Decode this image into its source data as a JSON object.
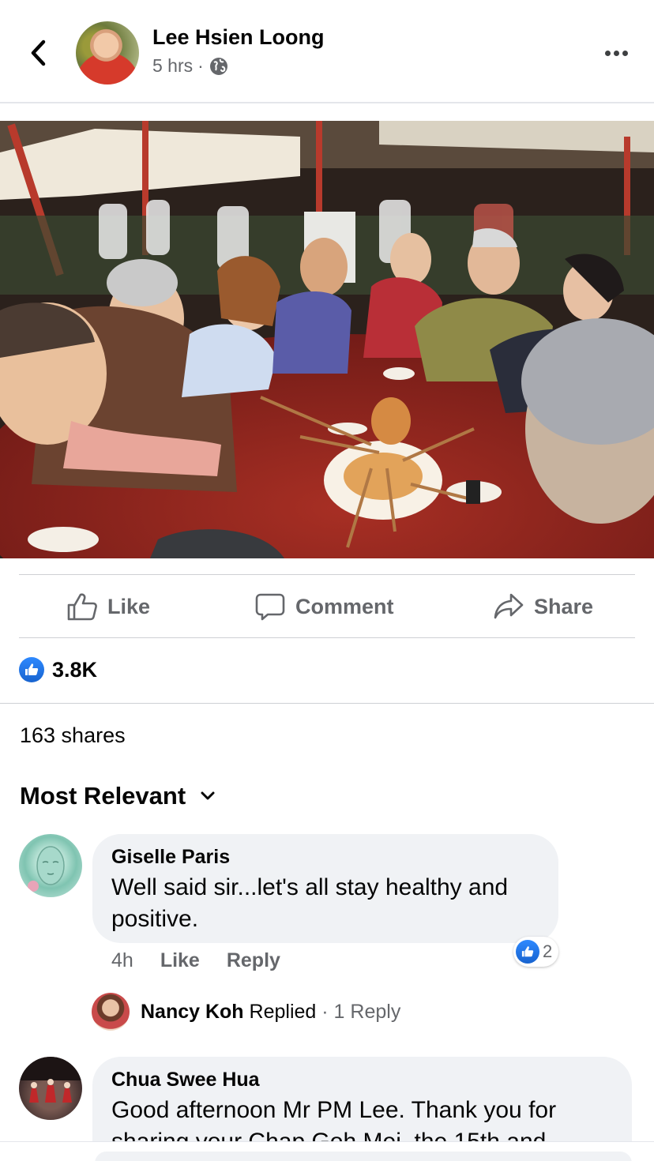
{
  "header": {
    "poster_name": "Lee Hsien Loong",
    "time": "5 hrs",
    "separator": "·",
    "privacy_icon": "globe-icon",
    "back_icon": "chevron-left-icon",
    "more_icon": "more-horizontal-icon"
  },
  "post": {
    "photo_icon": "post-photo"
  },
  "actions": {
    "like": "Like",
    "comment": "Comment",
    "share": "Share"
  },
  "reactions": {
    "type": "like",
    "count": "3.8K"
  },
  "shares": "163 shares",
  "sort": {
    "label": "Most Relevant",
    "icon": "chevron-down-icon"
  },
  "comments": [
    {
      "author": "Giselle Paris",
      "text": "Well said sir...let's all stay healthy and positive.",
      "time": "4h",
      "like_label": "Like",
      "reply_label": "Reply",
      "reaction_count": "2",
      "reply_preview": {
        "author": "Nancy Koh",
        "verb": "Replied",
        "count": "· 1 Reply"
      }
    },
    {
      "author": "Chua Swee Hua",
      "text": "Good afternoon Mr PM Lee. Thank you for sharing your Chap Goh Mei, the 15th and"
    }
  ],
  "colors": {
    "primary_text": "#050505",
    "secondary_text": "#65676b",
    "like_blue": "#1877f2",
    "bubble_bg": "#f0f2f5",
    "divider": "#ced0d4"
  }
}
